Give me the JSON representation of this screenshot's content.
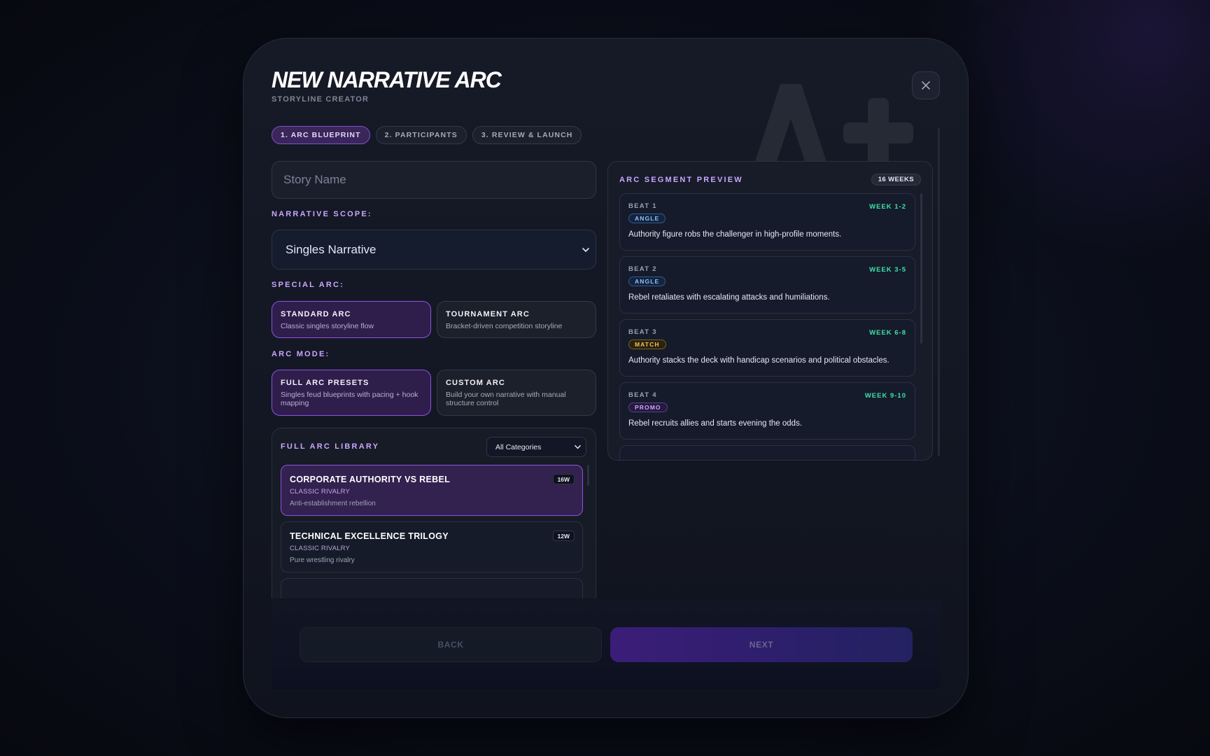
{
  "header": {
    "title": "NEW NARRATIVE ARC",
    "subtitle": "STORYLINE CREATOR",
    "close_icon": "close-icon"
  },
  "steps": [
    {
      "label": "1. ARC BLUEPRINT",
      "active": true
    },
    {
      "label": "2. PARTICIPANTS",
      "active": false
    },
    {
      "label": "3. REVIEW & LAUNCH",
      "active": false
    }
  ],
  "form": {
    "story_name": {
      "placeholder": "Story Name",
      "value": ""
    },
    "narrative_scope": {
      "label": "NARRATIVE SCOPE:",
      "selected": "Singles Narrative"
    },
    "special_arc": {
      "label": "SPECIAL ARC:",
      "options": [
        {
          "title": "STANDARD ARC",
          "desc": "Classic singles storyline flow",
          "active": true
        },
        {
          "title": "TOURNAMENT ARC",
          "desc": "Bracket-driven competition storyline",
          "active": false
        }
      ]
    },
    "arc_mode": {
      "label": "ARC MODE:",
      "options": [
        {
          "title": "FULL ARC PRESETS",
          "desc": "Singles feud blueprints with pacing + hook mapping",
          "active": true
        },
        {
          "title": "CUSTOM ARC",
          "desc": "Build your own narrative with manual structure control",
          "active": false
        }
      ]
    }
  },
  "library": {
    "label": "FULL ARC LIBRARY",
    "filter": "All Categories",
    "items": [
      {
        "title": "CORPORATE AUTHORITY VS REBEL",
        "category": "CLASSIC RIVALRY",
        "desc": "Anti-establishment rebellion",
        "weeks": "16W",
        "active": true
      },
      {
        "title": "TECHNICAL EXCELLENCE TRILOGY",
        "category": "CLASSIC RIVALRY",
        "desc": "Pure wrestling rivalry",
        "weeks": "12W",
        "active": false
      }
    ]
  },
  "preview": {
    "label": "ARC SEGMENT PREVIEW",
    "duration": "16 WEEKS",
    "beats": [
      {
        "beat": "BEAT 1",
        "week": "WEEK 1-2",
        "tag": "ANGLE",
        "tag_type": "angle",
        "text": "Authority figure robs the challenger in high-profile moments."
      },
      {
        "beat": "BEAT 2",
        "week": "WEEK 3-5",
        "tag": "ANGLE",
        "tag_type": "angle",
        "text": "Rebel retaliates with escalating attacks and humiliations."
      },
      {
        "beat": "BEAT 3",
        "week": "WEEK 6-8",
        "tag": "MATCH",
        "tag_type": "match",
        "text": "Authority stacks the deck with handicap scenarios and political obstacles."
      },
      {
        "beat": "BEAT 4",
        "week": "WEEK 9-10",
        "tag": "PROMO",
        "tag_type": "promo",
        "text": "Rebel recruits allies and starts evening the odds."
      }
    ]
  },
  "footer": {
    "back_label": "BACK",
    "next_label": "NEXT"
  },
  "colors": {
    "accent": "#8a55e0",
    "accent_text": "#c9a7ff",
    "week_green": "#3fe0a8",
    "background": "#0b0e1a"
  }
}
